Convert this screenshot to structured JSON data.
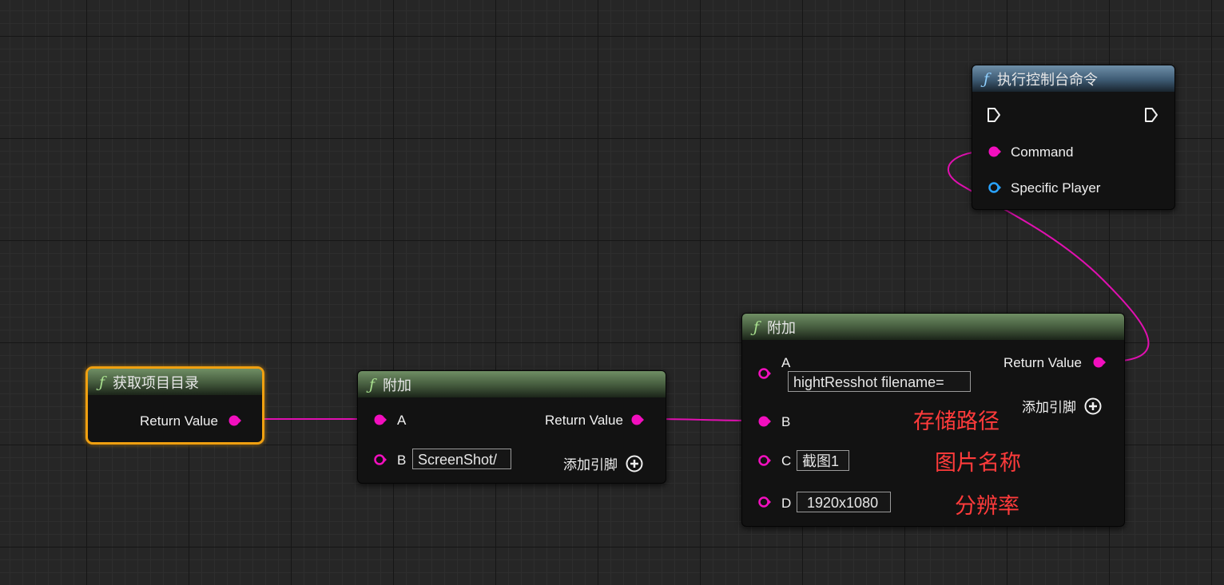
{
  "nodes": {
    "get_project_dir": {
      "title": "获取项目目录",
      "return_label": "Return Value"
    },
    "append1": {
      "title": "附加",
      "pin_a": "A",
      "pin_b": "B",
      "b_value": "ScreenShot/",
      "return_label": "Return Value",
      "add_pin": "添加引脚"
    },
    "append2": {
      "title": "附加",
      "pin_a": "A",
      "a_value": "hightResshot  filename=",
      "pin_b": "B",
      "pin_c": "C",
      "c_value": "截图1",
      "pin_d": "D",
      "d_value": "1920x1080",
      "return_label": "Return Value",
      "add_pin": "添加引脚"
    },
    "exec_console": {
      "title": "执行控制台命令",
      "command_label": "Command",
      "specific_player_label": "Specific Player"
    }
  },
  "annotations": {
    "path": "存储路径",
    "name": "图片名称",
    "resolution": "分辨率"
  },
  "colors": {
    "string_pin": "#f20fbe",
    "object_pin": "#29a3ff",
    "selection": "#f0a010",
    "annotation": "#ff3b3b",
    "pure_function_header": "#43593c",
    "function_header": "#3d5a73"
  },
  "icons": [
    "function-icon",
    "exec-pin-icon",
    "string-pin-icon",
    "object-pin-icon",
    "add-pin-icon"
  ]
}
